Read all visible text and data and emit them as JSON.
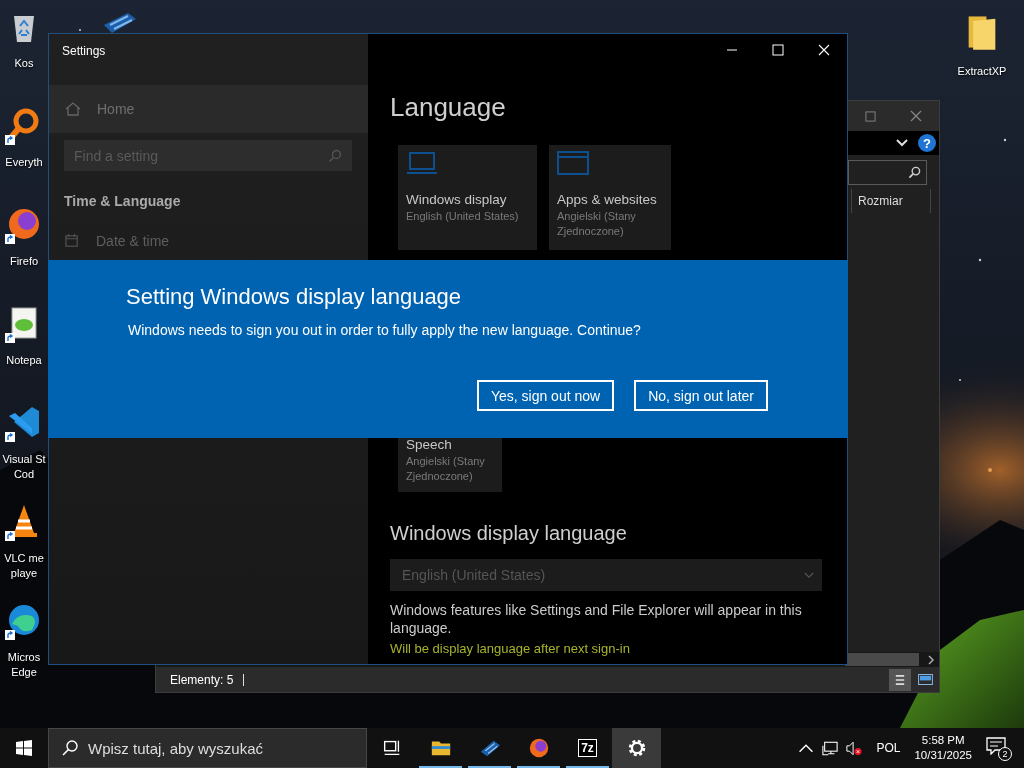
{
  "desktop_icons": [
    {
      "kind": "recycle-bin",
      "lines": [
        "Kos"
      ],
      "shortcut": false
    },
    {
      "kind": "everything",
      "lines": [
        "Everyth"
      ],
      "shortcut": true
    },
    {
      "kind": "firefox",
      "lines": [
        "Firefo"
      ],
      "shortcut": true
    },
    {
      "kind": "notepad",
      "lines": [
        "Notepa"
      ],
      "shortcut": true
    },
    {
      "kind": "vscode",
      "lines": [
        "Visual St",
        "Cod"
      ],
      "shortcut": true
    },
    {
      "kind": "vlc",
      "lines": [
        "VLC me",
        "playe"
      ],
      "shortcut": true
    },
    {
      "kind": "edge",
      "lines": [
        "Micros",
        "Edge"
      ],
      "shortcut": true
    }
  ],
  "desktop_icons_right": [
    {
      "kind": "folder",
      "lines": [
        "ExtractXP"
      ],
      "shortcut": false
    }
  ],
  "explorer_window": {
    "help_button": "?",
    "column_header": "Rozmiar",
    "status_text": "Elementy: 5"
  },
  "settings_window": {
    "title": "Settings",
    "sidebar": {
      "home": "Home",
      "search": {
        "placeholder": "Find a setting"
      },
      "section_title": "Time & Language",
      "items": [
        {
          "label": "Date & time"
        }
      ]
    },
    "page_title": "Language",
    "tiles": [
      {
        "kind": "display",
        "title": "Windows display",
        "subtitle": "English (United States)"
      },
      {
        "kind": "apps",
        "title": "Apps & websites",
        "subtitle": "Angielski (Stany Zjednoczone)"
      },
      {
        "kind": "speech",
        "title": "Speech",
        "subtitle": "Angielski (Stany Zjednoczone)"
      }
    ],
    "section": {
      "heading": "Windows display language",
      "dropdown": {
        "value": "English (United States)",
        "disabled": true
      },
      "description": "Windows features like Settings and File Explorer will appear in this language.",
      "status": "Will be display language after next sign-in"
    }
  },
  "dialog": {
    "title": "Setting Windows display language",
    "message": "Windows needs to sign you out in order to fully apply the new language. Continue?",
    "buttons": [
      "Yes, sign out now",
      "No, sign out later"
    ]
  },
  "taskbar": {
    "search": {
      "placeholder": "Wpisz tutaj, aby wyszukać"
    },
    "apps": [
      {
        "kind": "task-view",
        "running": false,
        "selected": false
      },
      {
        "kind": "file-explorer",
        "running": true,
        "selected": false
      },
      {
        "kind": "tiles",
        "running": true,
        "selected": false
      },
      {
        "kind": "firefox",
        "running": true,
        "selected": false
      },
      {
        "kind": "archiver",
        "label": "7z",
        "running": true,
        "selected": false
      },
      {
        "kind": "settings",
        "running": false,
        "selected": true
      }
    ],
    "tray": {
      "language": "POL",
      "time": "5:58 PM",
      "date": "10/31/2025",
      "notifications": "2"
    }
  }
}
